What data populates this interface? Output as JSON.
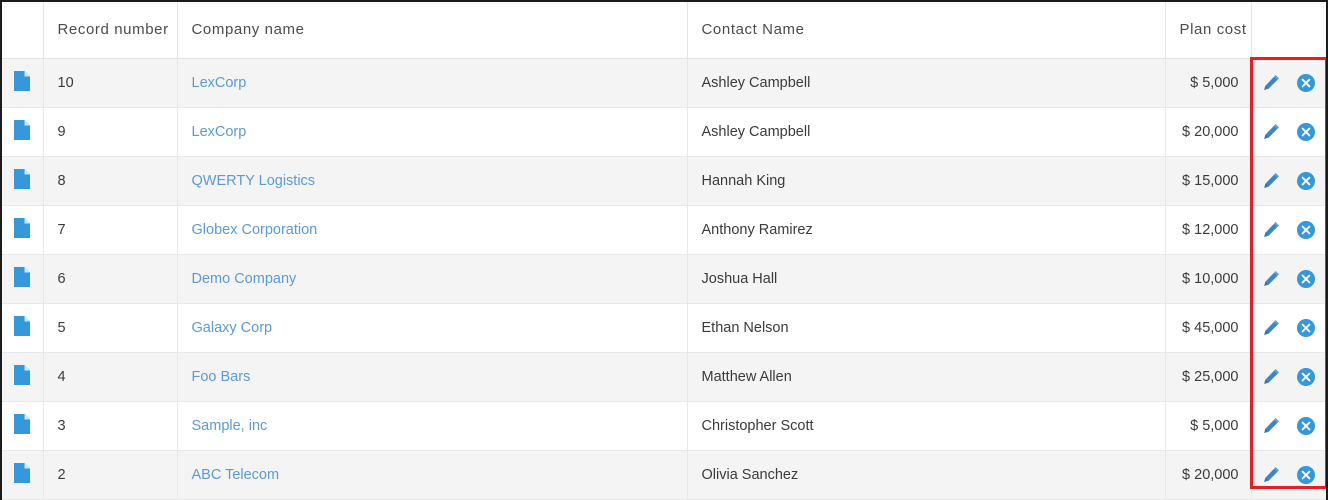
{
  "table": {
    "columns": [
      {
        "key": "doc",
        "label": ""
      },
      {
        "key": "record_number",
        "label": "Record number"
      },
      {
        "key": "company_name",
        "label": "Company name"
      },
      {
        "key": "contact_name",
        "label": "Contact Name"
      },
      {
        "key": "plan_cost",
        "label": "Plan cost"
      },
      {
        "key": "actions",
        "label": ""
      }
    ],
    "rows": [
      {
        "record_number": "10",
        "company_name": "LexCorp",
        "contact_name": "Ashley Campbell",
        "plan_cost": "$ 5,000"
      },
      {
        "record_number": "9",
        "company_name": "LexCorp",
        "contact_name": "Ashley Campbell",
        "plan_cost": "$ 20,000"
      },
      {
        "record_number": "8",
        "company_name": "QWERTY Logistics",
        "contact_name": "Hannah King",
        "plan_cost": "$ 15,000"
      },
      {
        "record_number": "7",
        "company_name": "Globex Corporation",
        "contact_name": "Anthony Ramirez",
        "plan_cost": "$ 12,000"
      },
      {
        "record_number": "6",
        "company_name": "Demo Company",
        "contact_name": "Joshua Hall",
        "plan_cost": "$ 10,000"
      },
      {
        "record_number": "5",
        "company_name": "Galaxy Corp",
        "contact_name": "Ethan Nelson",
        "plan_cost": "$ 45,000"
      },
      {
        "record_number": "4",
        "company_name": "Foo Bars",
        "contact_name": "Matthew Allen",
        "plan_cost": "$ 25,000"
      },
      {
        "record_number": "3",
        "company_name": "Sample, inc",
        "contact_name": "Christopher Scott",
        "plan_cost": "$ 5,000"
      },
      {
        "record_number": "2",
        "company_name": "ABC Telecom",
        "contact_name": "Olivia Sanchez",
        "plan_cost": "$ 20,000"
      }
    ]
  },
  "icons": {
    "row_document": "document-icon",
    "edit": "pencil-icon",
    "delete": "circle-x-icon"
  },
  "annotation": {
    "type": "highlight-rectangle",
    "target": "actions-column",
    "color": "#ec1c24"
  },
  "colors": {
    "link": "#5b9bd5",
    "icon_blue": "#3498db",
    "row_stripe": "#f4f4f4",
    "row_plain": "#ffffff",
    "header_text": "#4c4c4c",
    "cell_text": "#3b3b3b",
    "annotation_red": "#ec1c24"
  }
}
